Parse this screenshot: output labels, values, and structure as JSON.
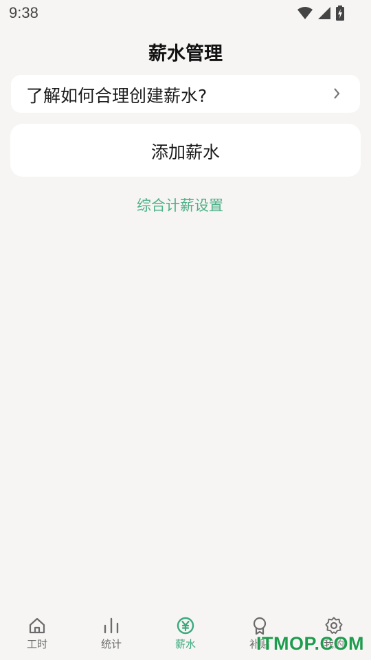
{
  "status_bar": {
    "time": "9:38"
  },
  "header": {
    "title": "薪水管理"
  },
  "help_card": {
    "label": "了解如何合理创建薪水?"
  },
  "add_card": {
    "label": "添加薪水"
  },
  "settings_link": {
    "label": "综合计薪设置"
  },
  "bottom_nav": {
    "items": [
      {
        "label": "工时",
        "icon": "home-icon"
      },
      {
        "label": "统计",
        "icon": "bar-chart-icon"
      },
      {
        "label": "薪水",
        "icon": "yen-icon",
        "active": true
      },
      {
        "label": "补贴",
        "icon": "badge-icon"
      },
      {
        "label": "我的",
        "icon": "gear-icon"
      }
    ]
  },
  "watermark": {
    "text": "ITMOP.COM"
  },
  "colors": {
    "accent": "#3aa97e",
    "background": "#f6f5f3",
    "card": "#ffffff"
  }
}
